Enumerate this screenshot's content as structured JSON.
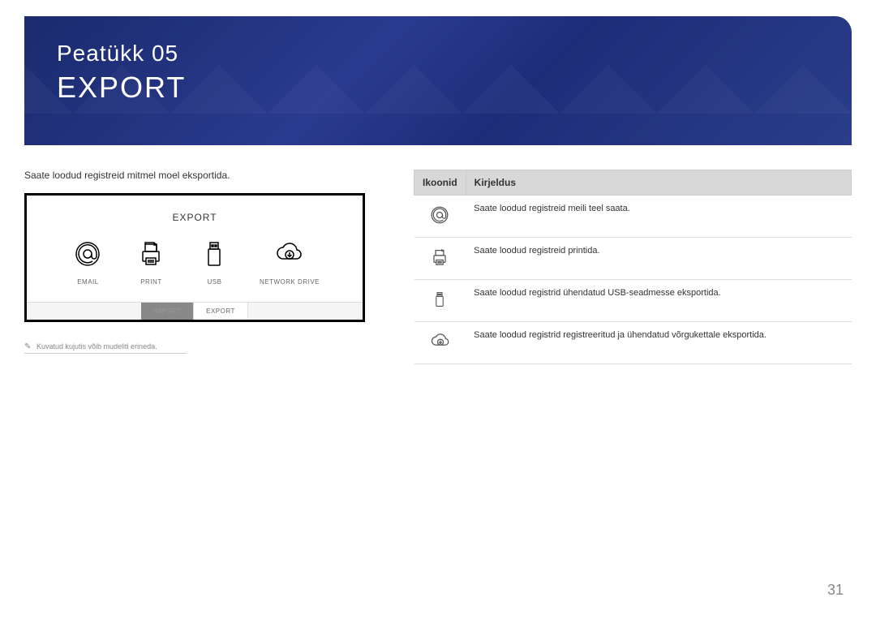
{
  "header": {
    "chapter_label": "Peatükk 05",
    "chapter_title": "EXPORT"
  },
  "intro_text": "Saate loodud registreid mitmel moel eksportida.",
  "export_panel": {
    "title": "EXPORT",
    "items": [
      {
        "label": "EMAIL"
      },
      {
        "label": "PRINT"
      },
      {
        "label": "USB"
      },
      {
        "label": "NETWORK DRIVE"
      }
    ],
    "tabs": {
      "import": "IMPORT",
      "export": "EXPORT"
    }
  },
  "disclaimer": "Kuvatud kujutis võib mudeliti erineda.",
  "table": {
    "headers": {
      "icons": "Ikoonid",
      "description": "Kirjeldus"
    },
    "rows": [
      {
        "description": "Saate loodud registreid meili teel saata."
      },
      {
        "description": "Saate loodud registreid printida."
      },
      {
        "description": "Saate loodud registrid ühendatud USB-seadmesse eksportida."
      },
      {
        "description": "Saate loodud registrid registreeritud ja ühendatud võrgukettale eksportida."
      }
    ]
  },
  "page_number": "31"
}
